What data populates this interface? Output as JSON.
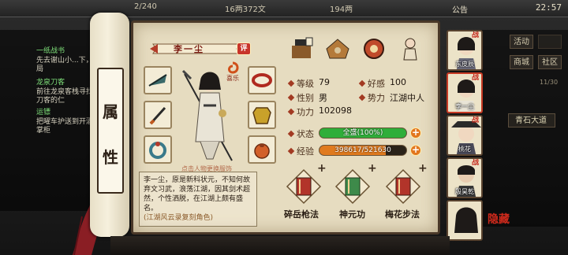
{
  "top_bar": {
    "stamina": "2/240",
    "money": "16两372文",
    "ingot": "194两",
    "announce": "公告",
    "clock": "22:57"
  },
  "quests": [
    {
      "title": "一纸战书",
      "desc": "先去谢山小...下，降刺局"
    },
    {
      "title": "龙泉刀客",
      "desc": "前往龙泉客栈寻找龙泉刀客的仁"
    },
    {
      "title": "运镖",
      "desc": "把曜车护送到开酒馆的掌柜"
    }
  ],
  "right_menu": {
    "activity": "活动",
    "shop": "商城",
    "guild": "社区",
    "count": "11/30",
    "stone": "青石大道"
  },
  "scroll": {
    "chars": [
      "属",
      "性"
    ]
  },
  "character": {
    "name": "李一尘",
    "ping_label": "评",
    "fortune_label": "喜乐",
    "change_tip": "点击人物更换服饰",
    "bio": "李一尘，原是新科状元，不知何故弃文习武，浪荡江湖，因其剑术超然，个性洒脱，在江湖上颇有盛名。",
    "bio_note": "(江湖风云录复刻角色)"
  },
  "stats": {
    "level_label": "等级",
    "level": "79",
    "favor_label": "好感",
    "favor": "100",
    "gender_label": "性别",
    "gender": "男",
    "faction_label": "势力",
    "faction": "江湖中人",
    "power_label": "功力",
    "power": "102098",
    "state_label": "状态",
    "state_text": "全盛(100%)",
    "state_pct": 1.0,
    "exp_label": "经验",
    "exp_text": "398617/521630",
    "exp_pct": 0.764
  },
  "skills": [
    {
      "name": "碎岳枪法"
    },
    {
      "name": "神元功"
    },
    {
      "name": "梅花步法"
    }
  ],
  "portraits": [
    {
      "name": "东皮辰"
    },
    {
      "name": "李一尘"
    },
    {
      "name": "桃花"
    },
    {
      "name": "殷昊乾"
    },
    {
      "name": ""
    }
  ],
  "hide_button": "隐藏",
  "colors": {
    "accent": "#c73a24",
    "state_bar": "#2fae3a",
    "exp_bar": "#e07a1e",
    "parchment": "#e6dcc0"
  },
  "icons": [
    "fan-icon",
    "sword-icon",
    "ring-icon",
    "bracelet-icon",
    "armor-icon",
    "pouch-icon",
    "gift-icon",
    "house-icon",
    "medal-icon",
    "scroll-book-icon",
    "scroll-book-icon",
    "scroll-book-icon"
  ]
}
